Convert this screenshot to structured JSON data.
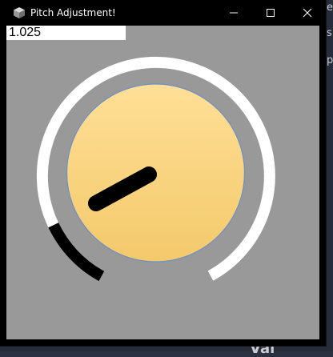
{
  "window": {
    "title": "Pitch Adjustment!",
    "app_icon": "cube-icon",
    "buttons": {
      "minimize_icon": "minimize-icon",
      "maximize_icon": "maximize-icon",
      "close_icon": "close-icon"
    }
  },
  "pitch": {
    "value_text": "1.025"
  },
  "knob": {
    "track_color": "#ffffff",
    "progress_color": "#000000",
    "face_color_top": "#ffdf97",
    "face_color_bottom": "#f3c96a",
    "face_border_color": "#6b8fc7",
    "indicator_color": "#000000",
    "client_background": "#999999"
  },
  "background": {
    "partial_text": [
      "e",
      "s",
      "p",
      "Val"
    ]
  }
}
